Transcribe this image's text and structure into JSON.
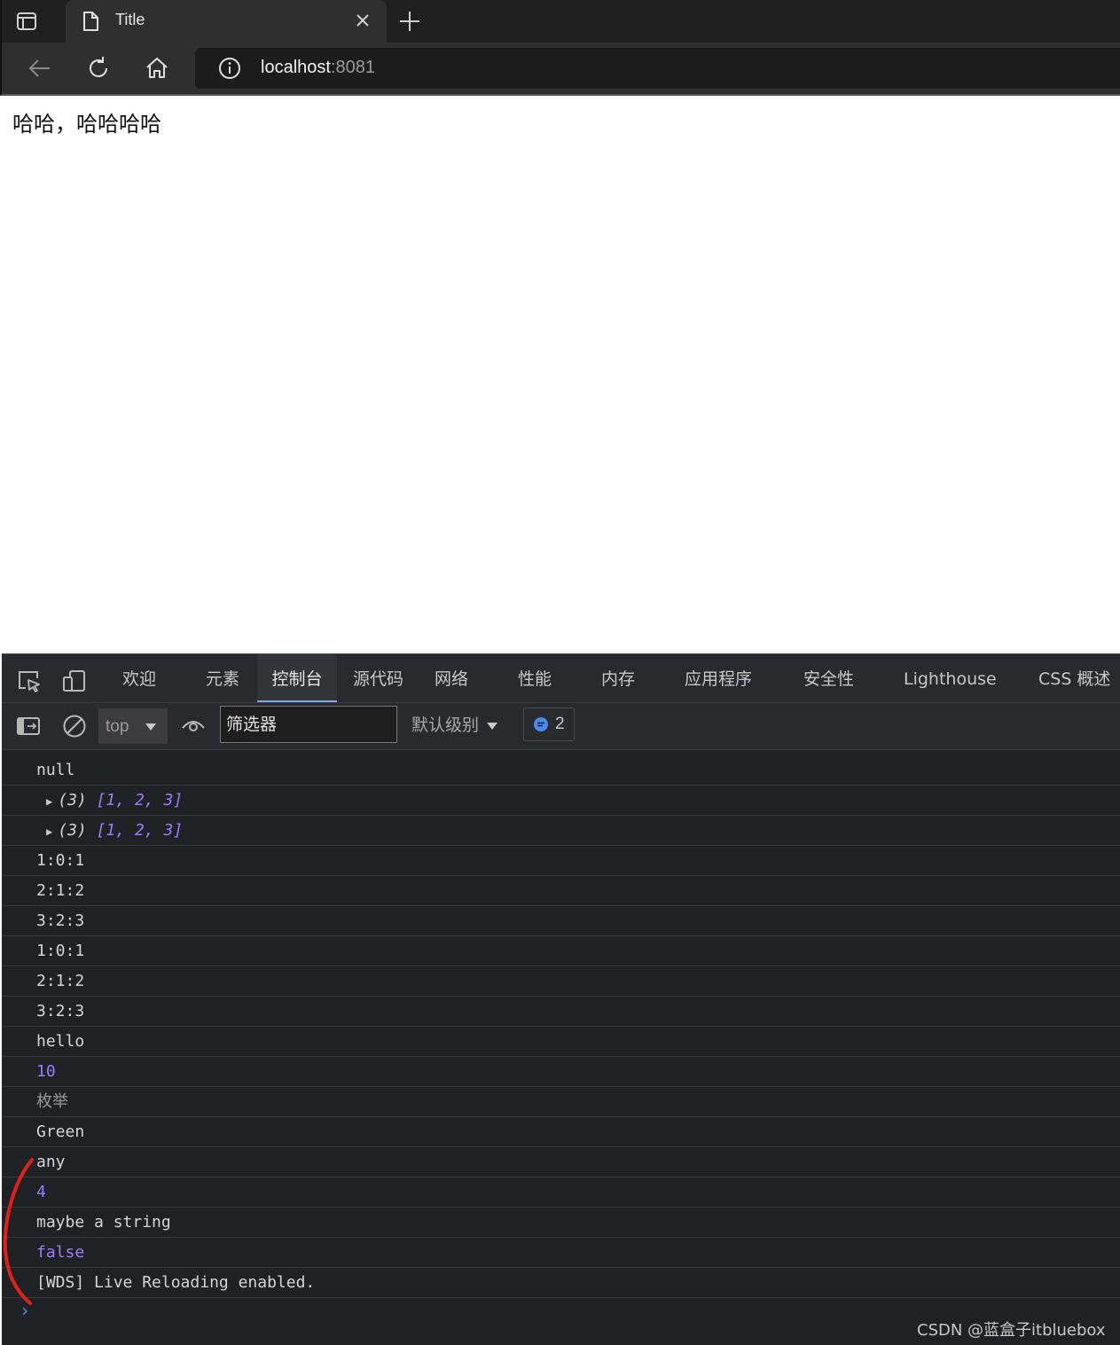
{
  "browser": {
    "tab_title": "Title",
    "url_host": "localhost",
    "url_port": ":8081"
  },
  "page": {
    "text": "哈哈，哈哈哈哈"
  },
  "devtools": {
    "tabs": [
      {
        "label": "欢迎"
      },
      {
        "label": "元素"
      },
      {
        "label": "控制台"
      },
      {
        "label": "源代码"
      },
      {
        "label": "网络"
      },
      {
        "label": "性能"
      },
      {
        "label": "内存"
      },
      {
        "label": "应用程序"
      },
      {
        "label": "安全性"
      },
      {
        "label": "Lighthouse"
      },
      {
        "label": "CSS 概述"
      }
    ],
    "active_tab": "控制台",
    "context": "top",
    "filter_placeholder": "筛选器",
    "levels_label": "默认级别",
    "issues_count": "2",
    "console": [
      {
        "text": "null",
        "kind": "plain"
      },
      {
        "prefix": "(3) ",
        "values": "[1, 2, 3]",
        "kind": "array"
      },
      {
        "prefix": "(3) ",
        "values": "[1, 2, 3]",
        "kind": "array"
      },
      {
        "text": "1:0:1",
        "kind": "plain"
      },
      {
        "text": "2:1:2",
        "kind": "plain"
      },
      {
        "text": "3:2:3",
        "kind": "plain"
      },
      {
        "text": "1:0:1",
        "kind": "plain"
      },
      {
        "text": "2:1:2",
        "kind": "plain"
      },
      {
        "text": "3:2:3",
        "kind": "plain"
      },
      {
        "text": "hello",
        "kind": "plain"
      },
      {
        "text": "10",
        "kind": "number"
      },
      {
        "text": "枚举",
        "kind": "gray"
      },
      {
        "text": "Green",
        "kind": "plain"
      },
      {
        "text": "any",
        "kind": "plain"
      },
      {
        "text": "4",
        "kind": "number"
      },
      {
        "text": "maybe a string",
        "kind": "plain"
      },
      {
        "text": "false",
        "kind": "number"
      },
      {
        "text": "[WDS] Live Reloading enabled.",
        "kind": "plain"
      }
    ],
    "prompt": "›"
  },
  "watermark": "CSDN @蓝盒子itbluebox",
  "colors": {
    "active_tab_underline": "#7cacf8",
    "number_value": "#9a7dff",
    "annotation_red": "#e0201b"
  }
}
